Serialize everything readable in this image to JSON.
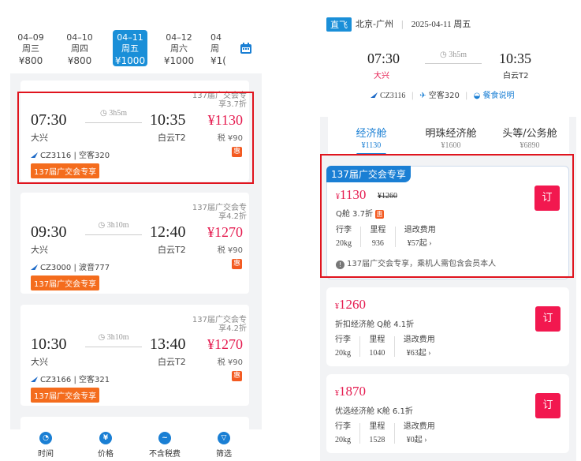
{
  "left": {
    "dates": [
      {
        "date": "04–09",
        "weekday": "周三",
        "price": "¥800"
      },
      {
        "date": "04–10",
        "weekday": "周四",
        "price": "¥800"
      },
      {
        "date": "04–11",
        "weekday": "周五",
        "price": "¥1000"
      },
      {
        "date": "04–12",
        "weekday": "周六",
        "price": "¥1000"
      },
      {
        "date": "04",
        "weekday": "周",
        "price": "¥1("
      }
    ],
    "flights": [
      {
        "dep_time": "07:30",
        "arr_time": "10:35",
        "dep_airport": "大兴",
        "arr_airport": "白云T2",
        "duration": "3h5m",
        "promo": "137届广交会专享3.7折",
        "price": "¥1130",
        "tax": "税 ¥90",
        "flight_info": "CZ3116 | 空客320",
        "badge": "137届广交会专享",
        "hui": "惠"
      },
      {
        "dep_time": "09:30",
        "arr_time": "12:40",
        "dep_airport": "大兴",
        "arr_airport": "白云T2",
        "duration": "3h10m",
        "promo": "137届广交会专享4.2折",
        "price": "¥1270",
        "tax": "税 ¥90",
        "flight_info": "CZ3000 | 波音777",
        "badge": "137届广交会专享",
        "hui": "惠"
      },
      {
        "dep_time": "10:30",
        "arr_time": "13:40",
        "dep_airport": "大兴",
        "arr_airport": "白云T2",
        "duration": "3h10m",
        "promo": "137届广交会专享4.2折",
        "price": "¥1270",
        "tax": "税 ¥90",
        "flight_info": "CZ3166 | 空客321",
        "badge": "137届广交会专享",
        "hui": "惠"
      }
    ],
    "nav": [
      {
        "label": "时间",
        "icon": "clock-icon"
      },
      {
        "label": "价格",
        "icon": "yen-icon"
      },
      {
        "label": "不含税费",
        "icon": "trend-icon"
      },
      {
        "label": "筛选",
        "icon": "filter-icon"
      }
    ]
  },
  "right": {
    "direct_tag": "直飞",
    "route": "北京-广州",
    "date": "2025-04-11 周五",
    "dep_time": "07:30",
    "arr_time": "10:35",
    "dep_airport": "大兴",
    "arr_airport": "白云T2",
    "duration": "3h5m",
    "flight_no": "CZ3116",
    "aircraft": "空客320",
    "meal": "餐食说明",
    "tabs": [
      {
        "label": "经济舱",
        "price": "¥1130"
      },
      {
        "label": "明珠经济舱",
        "price": "¥1600"
      },
      {
        "label": "头等/公务舱",
        "price": "¥6890"
      }
    ],
    "fares": [
      {
        "tag": "137届广交会专享",
        "price": "1130",
        "old_price": "¥1260",
        "cabin": "Q舱 3.7折",
        "baggage_label": "行李",
        "baggage": "20kg",
        "miles_label": "里程",
        "miles": "936",
        "refund_label": "退改费用",
        "refund": "¥57起",
        "note": "137届广交会专享，乘机人需包含会员本人",
        "book": "订"
      },
      {
        "price": "1260",
        "cabin": "折扣经济舱 Q舱 4.1折",
        "baggage_label": "行李",
        "baggage": "20kg",
        "miles_label": "里程",
        "miles": "1040",
        "refund_label": "退改费用",
        "refund": "¥63起",
        "book": "订"
      },
      {
        "price": "1870",
        "cabin": "优选经济舱 K舱 6.1折",
        "baggage_label": "行李",
        "baggage": "20kg",
        "miles_label": "里程",
        "miles": "1528",
        "refund_label": "退改费用",
        "refund": "¥0起",
        "book": "订"
      }
    ]
  },
  "colors": {
    "accent": "#1a7fd4",
    "price": "#e51c50",
    "badge": "#f46c1d",
    "highlight": "#e0141e"
  }
}
